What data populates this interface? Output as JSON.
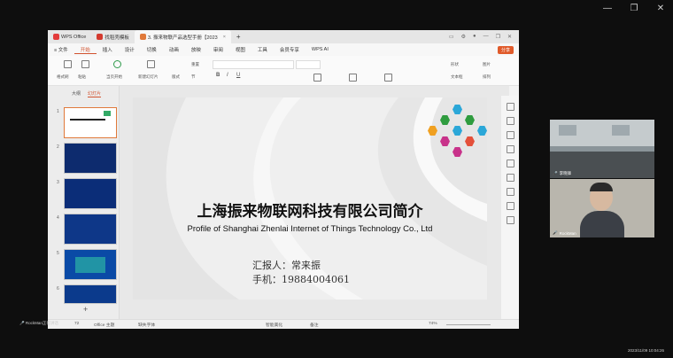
{
  "window_controls": [
    "—",
    "❐",
    "✕"
  ],
  "tabs": [
    {
      "label": "WPS Office",
      "color": "#e33b3b"
    },
    {
      "label": "找稻壳模板",
      "color": "#d43a2f"
    },
    {
      "label": "3. 振来物联产品选型手册【2023",
      "color": "#e0793a"
    }
  ],
  "menu": [
    "≡ 文件",
    "开始",
    "插入",
    "设计",
    "切换",
    "动画",
    "放映",
    "审阅",
    "视图",
    "工具",
    "会员专享",
    "WPS AI"
  ],
  "menu_active": "开始",
  "share_label": "分享",
  "ribbon_labels": {
    "format_painter": "格式刷",
    "paste": "粘贴",
    "play": "当页开始",
    "new_slide": "新建幻灯片",
    "layout": "版式",
    "section": "节",
    "reset": "重置",
    "shape": "形状",
    "arrange": "排列",
    "textbox": "文本框",
    "picture": "图片"
  },
  "left_panel": {
    "tab_outline": "大纲",
    "tab_slides": "幻灯片",
    "thumb_numbers": [
      "1",
      "2",
      "3",
      "4",
      "5",
      "6"
    ],
    "add": "+"
  },
  "slide": {
    "title_cn": "上海振来物联网科技有限公司简介",
    "title_en": "Profile of Shanghai Zhenlai Internet of Things Technology Co., Ltd",
    "reporter": "汇报人：常来振",
    "phone": "手机：19884004061"
  },
  "statusbar": {
    "slide_count": "72",
    "theme": "Office 主题",
    "font_missing": "缺失字体",
    "smart_beautify": "智能美化",
    "notes": "备注",
    "zoom": "74%"
  },
  "bottom_user": "RockMan正在讲话",
  "timestamp": "2023/11/09 10:04:26",
  "videos": [
    {
      "name": "李晓锋"
    },
    {
      "name": "RockMan"
    }
  ],
  "colors": {
    "accent": "#d2532f",
    "wps_red": "#e33b3b"
  }
}
